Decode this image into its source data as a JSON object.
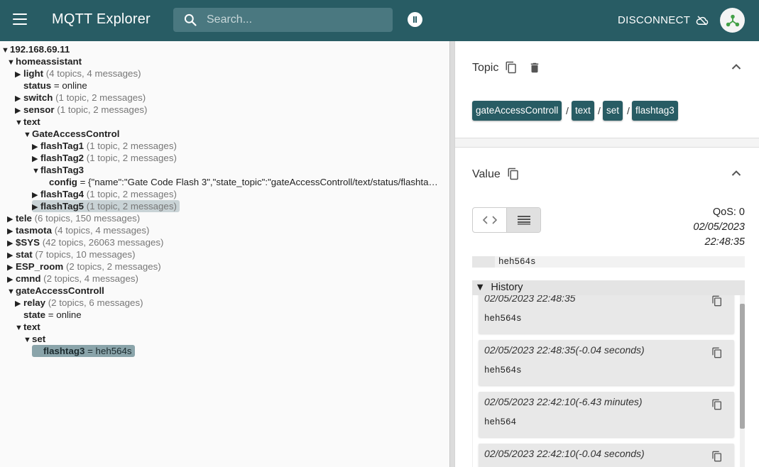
{
  "app": {
    "title": "MQTT Explorer",
    "search_placeholder": "Search...",
    "disconnect_label": "DISCONNECT",
    "accent": "#285c64"
  },
  "tree": [
    {
      "arrow": "▼",
      "name": "192.168.69.11",
      "meta": "",
      "value": "",
      "depth": 0
    },
    {
      "arrow": "▼",
      "name": "homeassistant",
      "meta": "",
      "value": "",
      "depth": 1
    },
    {
      "arrow": "▶",
      "name": "light",
      "meta": " (4 topics, 4 messages)",
      "value": "",
      "depth": 2
    },
    {
      "arrow": "",
      "name": "status",
      "meta": "",
      "value": " = online",
      "depth": 2
    },
    {
      "arrow": "▶",
      "name": "switch",
      "meta": " (1 topic, 2 messages)",
      "value": "",
      "depth": 2
    },
    {
      "arrow": "▶",
      "name": "sensor",
      "meta": " (1 topic, 2 messages)",
      "value": "",
      "depth": 2
    },
    {
      "arrow": "▼",
      "name": "text",
      "meta": "",
      "value": "",
      "depth": 2
    },
    {
      "arrow": "▼",
      "name": "GateAccessControl",
      "meta": "",
      "value": "",
      "depth": 3
    },
    {
      "arrow": "▶",
      "name": "flashTag1",
      "meta": " (1 topic, 2 messages)",
      "value": "",
      "depth": 4
    },
    {
      "arrow": "▶",
      "name": "flashTag2",
      "meta": " (1 topic, 2 messages)",
      "value": "",
      "depth": 4
    },
    {
      "arrow": "▼",
      "name": "flashTag3",
      "meta": "",
      "value": "",
      "depth": 4
    },
    {
      "arrow": "",
      "name": "config",
      "meta": "",
      "value": " = {\"name\":\"Gate Code Flash 3\",\"state_topic\":\"gateAccessControll/text/status/flashta…",
      "depth": 5
    },
    {
      "arrow": "▶",
      "name": "flashTag4",
      "meta": " (1 topic, 2 messages)",
      "value": "",
      "depth": 4
    },
    {
      "arrow": "▶",
      "name": "flashTag5",
      "meta": " (1 topic, 2 messages)",
      "value": "",
      "depth": 4,
      "highlight": "light"
    },
    {
      "arrow": "▶",
      "name": "tele",
      "meta": " (6 topics, 150 messages)",
      "value": "",
      "depth": 1
    },
    {
      "arrow": "▶",
      "name": "tasmota",
      "meta": " (4 topics, 4 messages)",
      "value": "",
      "depth": 1
    },
    {
      "arrow": "▶",
      "name": "$SYS",
      "meta": " (42 topics, 26063 messages)",
      "value": "",
      "depth": 1
    },
    {
      "arrow": "▶",
      "name": "stat",
      "meta": " (7 topics, 10 messages)",
      "value": "",
      "depth": 1
    },
    {
      "arrow": "▶",
      "name": "ESP_room",
      "meta": " (2 topics, 2 messages)",
      "value": "",
      "depth": 1
    },
    {
      "arrow": "▶",
      "name": "cmnd",
      "meta": " (2 topics, 4 messages)",
      "value": "",
      "depth": 1
    },
    {
      "arrow": "▼",
      "name": "gateAccessControll",
      "meta": "",
      "value": "",
      "depth": 1
    },
    {
      "arrow": "▶",
      "name": "relay",
      "meta": " (2 topics, 6 messages)",
      "value": "",
      "depth": 2
    },
    {
      "arrow": "",
      "name": "state",
      "meta": "",
      "value": " = online",
      "depth": 2
    },
    {
      "arrow": "▼",
      "name": "text",
      "meta": "",
      "value": "",
      "depth": 2
    },
    {
      "arrow": "▼",
      "name": "set",
      "meta": "",
      "value": "",
      "depth": 3
    },
    {
      "arrow": "",
      "name": "flashtag3",
      "meta": "",
      "value": " = heh564s",
      "depth": 4,
      "highlight": "dark"
    }
  ],
  "topic": {
    "title": "Topic",
    "path": [
      "gateAccessControll",
      "text",
      "set",
      "flashtag3"
    ],
    "separator": "/"
  },
  "value": {
    "title": "Value",
    "qos": "QoS: 0",
    "date": "02/05/2023",
    "time": "22:48:35",
    "content": "heh564s"
  },
  "history": {
    "title": "History",
    "arrow": "▼",
    "items": [
      {
        "time": "02/05/2023 22:48:35",
        "value": "heh564s"
      },
      {
        "time": "02/05/2023 22:48:35(-0.04 seconds)",
        "value": "heh564s"
      },
      {
        "time": "02/05/2023 22:42:10(-6.43 minutes)",
        "value": "heh564"
      },
      {
        "time": "02/05/2023 22:42:10(-0.04 seconds)",
        "value": ""
      }
    ]
  }
}
